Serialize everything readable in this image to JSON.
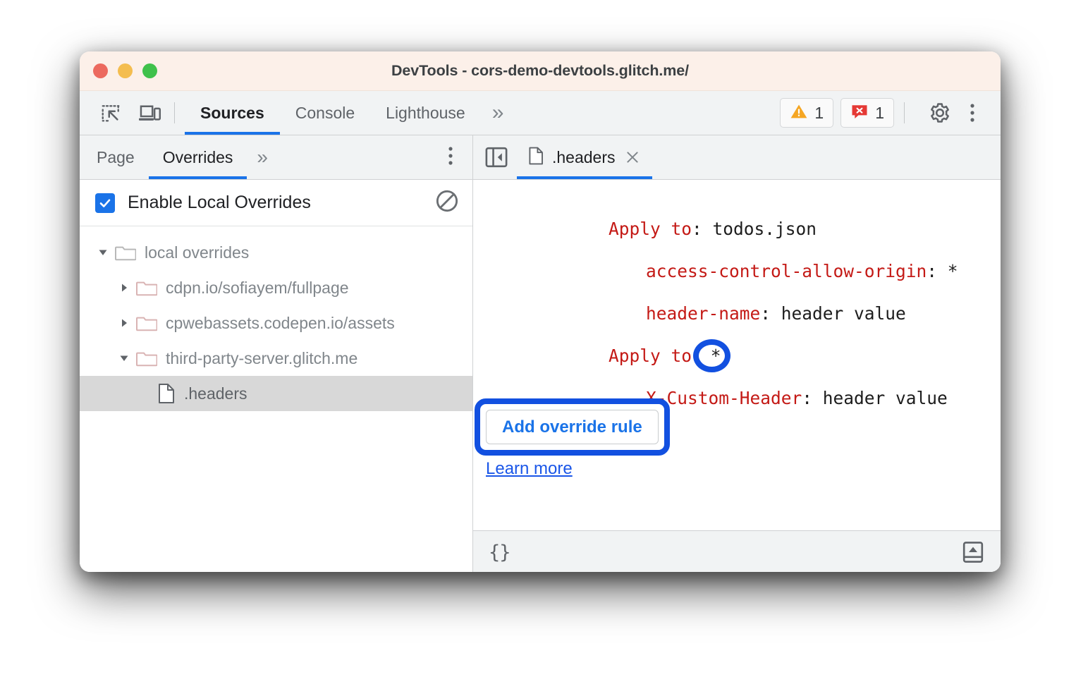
{
  "window": {
    "title": "DevTools - cors-demo-devtools.glitch.me/",
    "traffic_lights": [
      "close-red",
      "minimize-yellow",
      "zoom-green"
    ]
  },
  "toolbar": {
    "inspect_icon": "inspect-element-icon",
    "device_icon": "device-toolbar-icon",
    "panels": [
      {
        "label": "Sources",
        "active": true
      },
      {
        "label": "Console",
        "active": false
      },
      {
        "label": "Lighthouse",
        "active": false
      }
    ],
    "more_panels": "»",
    "warning_count": "1",
    "error_count": "1",
    "settings_icon": "gear-icon",
    "menu_icon": "kebab-menu-icon"
  },
  "navigator": {
    "tabs": [
      {
        "label": "Page",
        "active": false
      },
      {
        "label": "Overrides",
        "active": true
      }
    ],
    "more_tabs": "»",
    "kebab_icon": "kebab-menu-icon",
    "enable_overrides": {
      "label": "Enable Local Overrides",
      "checked": true,
      "clear_icon": "clear-configuration-icon"
    },
    "tree": [
      {
        "label": "local overrides",
        "type": "folder",
        "level": 0,
        "expanded": true,
        "selected": false
      },
      {
        "label": "cdpn.io/sofiayem/fullpage",
        "type": "folder",
        "level": 1,
        "expanded": false,
        "selected": false
      },
      {
        "label": "cpwebassets.codepen.io/assets",
        "type": "folder",
        "level": 1,
        "expanded": false,
        "selected": false
      },
      {
        "label": "third-party-server.glitch.me",
        "type": "folder",
        "level": 1,
        "expanded": true,
        "selected": false
      },
      {
        "label": ".headers",
        "type": "file",
        "level": 2,
        "expanded": null,
        "selected": true
      }
    ]
  },
  "editor": {
    "sidebar_toggle_icon": "show-navigator-icon",
    "tab": {
      "label": ".headers",
      "file_icon": "file-icon",
      "close_icon": "close-icon"
    },
    "lines": [
      {
        "key": "Apply to",
        "sep": ": ",
        "value": "todos.json",
        "indent": 0
      },
      {
        "key": "access-control-allow-origin",
        "sep": ": ",
        "value": "*",
        "indent": 1
      },
      {
        "key": "header-name",
        "sep": ": ",
        "value": "header value",
        "indent": 1
      },
      {
        "key": "Apply to",
        "sep": ":",
        "value": "*",
        "indent": 0
      },
      {
        "key": "X-Custom-Header",
        "sep": ": ",
        "value": "header value",
        "indent": 1
      }
    ],
    "row_actions": {
      "add_icon": "plus-icon",
      "delete_icon": "trash-icon"
    },
    "add_override_rule_label": "Add override rule",
    "learn_more_label": "Learn more"
  },
  "statusbar": {
    "format_label": "{}",
    "drawer_icon": "show-drawer-icon"
  },
  "highlights": [
    {
      "name": "row-actions-highlight",
      "shape": "rounded-rect"
    },
    {
      "name": "apply-to-value-highlight",
      "shape": "circle"
    },
    {
      "name": "add-override-rule-highlight",
      "shape": "rounded-rect"
    }
  ],
  "colors": {
    "accent_blue": "#1a73e8",
    "highlight_blue": "#1250e0",
    "header_key_red": "#c41a16",
    "titlebar_bg": "#fcf0e9",
    "toolbar_bg": "#f1f3f4",
    "selected_row_bg": "#d8d8d8",
    "warning_orange": "#f5a623",
    "error_red": "#e53935"
  }
}
